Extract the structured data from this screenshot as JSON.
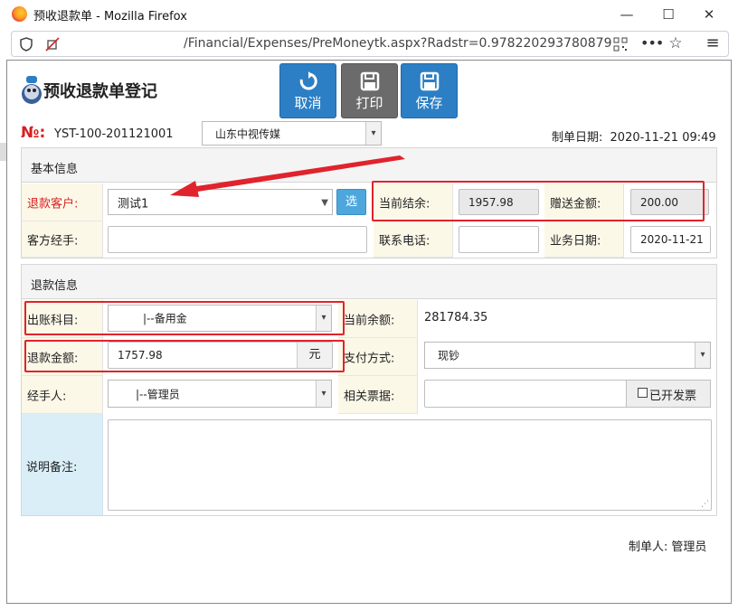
{
  "browser": {
    "window_title": "预收退款单 - Mozilla Firefox",
    "url": "/Financial/Expenses/PreMoneytk.aspx?Radstr=0.978220293780879",
    "btn_minimize": "—",
    "btn_maximize": "☐",
    "btn_close": "✕"
  },
  "header": {
    "title": "预收退款单登记",
    "buttons": {
      "cancel": "取消",
      "print": "打印",
      "save": "保存"
    }
  },
  "doc": {
    "no_label": "№:",
    "no_value": "YST-100-201121001",
    "company": "山东中视传媒",
    "date_label": "制单日期:",
    "date_value": "2020-11-21 09:49"
  },
  "basic": {
    "section_title": "基本信息",
    "customer_label": "退款客户:",
    "customer_value": "测试1",
    "select_btn": "选",
    "balance_label": "当前结余:",
    "balance_value": "1957.98",
    "gift_label": "赠送金额:",
    "gift_value": "200.00",
    "manager_label": "客方经手:",
    "manager_value": "",
    "phone_label": "联系电话:",
    "phone_value": "",
    "bizdate_label": "业务日期:",
    "bizdate_value": "2020-11-21"
  },
  "refund": {
    "section_title": "退款信息",
    "account_label": "出账科目:",
    "account_value": "|--备用金",
    "cur_balance_label": "当前余额:",
    "cur_balance_value": "281784.35",
    "amount_label": "退款金额:",
    "amount_value": "1757.98",
    "amount_unit": "元",
    "pay_label": "支付方式:",
    "pay_value": "现钞",
    "handler_label": "经手人:",
    "handler_value": "|--管理员",
    "bills_label": "相关票据:",
    "bills_value": "",
    "invoice_label": "已开发票",
    "remark_label": "说明备注:",
    "remark_value": ""
  },
  "footer": {
    "maker_label": "制单人:",
    "maker_value": "管理员"
  },
  "colors": {
    "accent_blue": "#2c7fc4",
    "print_gray": "#6b6b6b",
    "highlight_red": "#e0232c",
    "label_bg": "#fcf8e8",
    "remark_label_bg": "#daeef8"
  },
  "icons": [
    "firefox-icon",
    "shield-icon",
    "no-tracking-icon",
    "qr-icon",
    "more-icon",
    "star-icon",
    "menu-icon",
    "refresh-icon",
    "floppy-icon",
    "arrow-annotation"
  ]
}
